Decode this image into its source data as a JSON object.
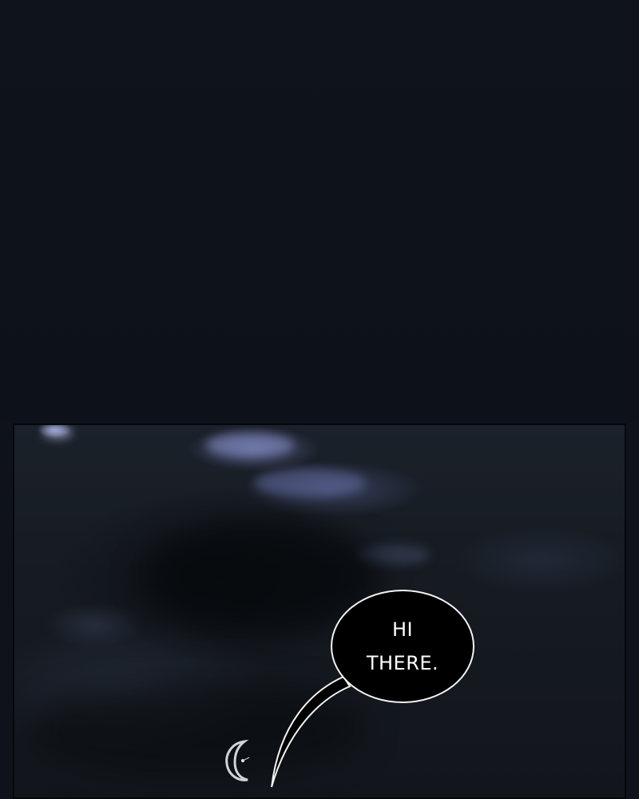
{
  "scene": {
    "description_colors": {
      "background": "#0e121a",
      "sky": "#161b22",
      "cloud_highlight": "#7a84c0",
      "bubble_fill": "#000000",
      "bubble_outline": "#f2f2f2",
      "text": "#ffffff"
    }
  },
  "speech_bubble": {
    "text": "HI\nTHERE."
  },
  "icons": {
    "moon": "crescent-moon-icon"
  }
}
